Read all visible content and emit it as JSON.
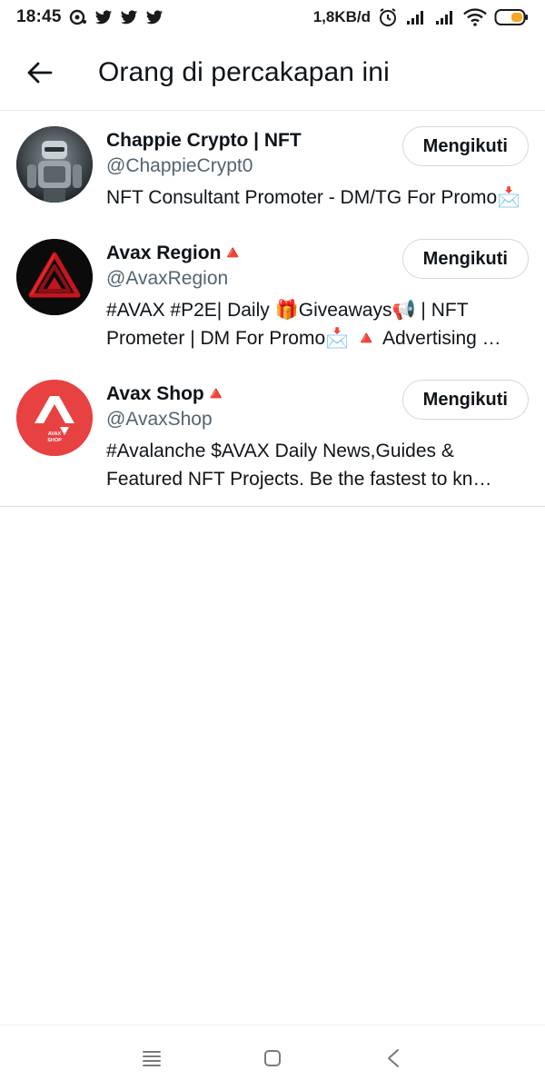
{
  "status_bar": {
    "time": "18:45",
    "net_speed": "1,8KB/d",
    "icons": [
      "notification-dot-icon",
      "twitter-icon",
      "twitter-icon",
      "twitter-icon",
      "alarm-icon",
      "signal-icon",
      "signal-icon",
      "wifi-icon",
      "battery-icon"
    ],
    "battery_color": "#f5a623"
  },
  "header": {
    "back_icon": "arrow-left-icon",
    "title": "Orang di percakapan ini"
  },
  "users": [
    {
      "display_name": "Chappie Crypto | NFT",
      "handle": "@ChappieCrypt0",
      "bio": "NFT Consultant Promoter - DM/TG For Promo📩",
      "follow_label": "Mengikuti",
      "avatar_icon": "robot-avatar"
    },
    {
      "display_name": "Avax Region🔺",
      "handle": "@AvaxRegion",
      "bio": "#AVAX  #P2E| Daily 🎁Giveaways📢 | NFT Prometer | DM For Promo📩 🔺 Advertising …",
      "follow_label": "Mengikuti",
      "avatar_icon": "red-triangle-avatar"
    },
    {
      "display_name": "Avax Shop🔺",
      "handle": "@AvaxShop",
      "bio": "#Avalanche $AVAX Daily News,Guides & Featured NFT Projects. Be the fastest to kn…",
      "follow_label": "Mengikuti",
      "avatar_icon": "avax-shop-avatar",
      "avatar_text_1": "AVAX",
      "avatar_text_2": "SHOP"
    }
  ],
  "nav_bar": {
    "icons": [
      "menu-icon",
      "home-square-icon",
      "back-chevron-icon"
    ]
  },
  "colors": {
    "text_primary": "#0f1419",
    "text_secondary": "#536471",
    "border": "#cfd9de",
    "avax_red": "#e84142"
  }
}
